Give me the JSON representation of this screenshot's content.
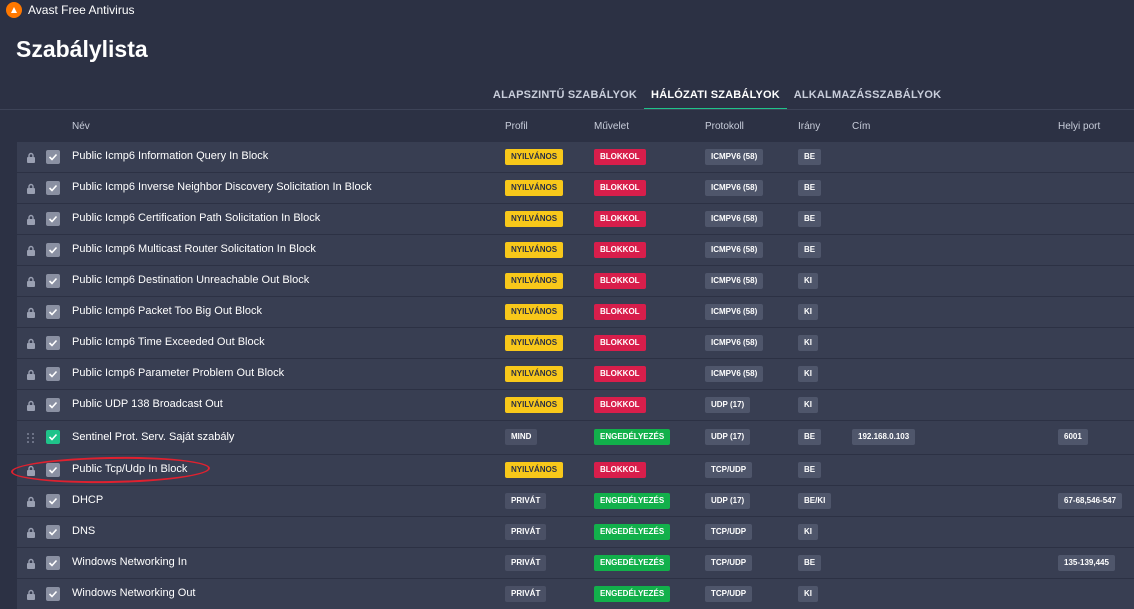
{
  "app": {
    "title": "Avast Free Antivirus"
  },
  "page": {
    "title": "Szabálylista"
  },
  "tabs": [
    {
      "label": "ALAPSZINTŰ SZABÁLYOK",
      "active": false
    },
    {
      "label": "HÁLÓZATI SZABÁLYOK",
      "active": true
    },
    {
      "label": "ALKALMAZÁSSZABÁLYOK",
      "active": false
    }
  ],
  "columns": {
    "name": "Név",
    "profile": "Profil",
    "action": "Művelet",
    "protocol": "Protokoll",
    "direction": "Irány",
    "address": "Cím",
    "local_port": "Helyi port"
  },
  "colors": {
    "public": "#f8c81a",
    "block": "#d81e4b",
    "allow": "#12b04b",
    "accent_tab": "#1fc38a",
    "annotation": "#e0212f"
  },
  "rows": [
    {
      "name": "Public Icmp6 Information Query In Block",
      "profile": "NYILVÁNOS",
      "action": "BLOKKOL",
      "protocol": "ICMPV6 (58)",
      "direction": "BE",
      "address": "",
      "port": ""
    },
    {
      "name": "Public Icmp6 Inverse Neighbor Discovery Solicitation In Block",
      "profile": "NYILVÁNOS",
      "action": "BLOKKOL",
      "protocol": "ICMPV6 (58)",
      "direction": "BE",
      "address": "",
      "port": ""
    },
    {
      "name": "Public Icmp6 Certification Path Solicitation In Block",
      "profile": "NYILVÁNOS",
      "action": "BLOKKOL",
      "protocol": "ICMPV6 (58)",
      "direction": "BE",
      "address": "",
      "port": ""
    },
    {
      "name": "Public Icmp6 Multicast Router Solicitation In Block",
      "profile": "NYILVÁNOS",
      "action": "BLOKKOL",
      "protocol": "ICMPV6 (58)",
      "direction": "BE",
      "address": "",
      "port": ""
    },
    {
      "name": "Public Icmp6 Destination Unreachable Out Block",
      "profile": "NYILVÁNOS",
      "action": "BLOKKOL",
      "protocol": "ICMPV6 (58)",
      "direction": "KI",
      "address": "",
      "port": ""
    },
    {
      "name": "Public Icmp6 Packet Too Big Out Block",
      "profile": "NYILVÁNOS",
      "action": "BLOKKOL",
      "protocol": "ICMPV6 (58)",
      "direction": "KI",
      "address": "",
      "port": ""
    },
    {
      "name": "Public Icmp6 Time Exceeded Out Block",
      "profile": "NYILVÁNOS",
      "action": "BLOKKOL",
      "protocol": "ICMPV6 (58)",
      "direction": "KI",
      "address": "",
      "port": ""
    },
    {
      "name": "Public Icmp6 Parameter Problem Out Block",
      "profile": "NYILVÁNOS",
      "action": "BLOKKOL",
      "protocol": "ICMPV6 (58)",
      "direction": "KI",
      "address": "",
      "port": ""
    },
    {
      "name": "Public UDP 138 Broadcast Out",
      "profile": "NYILVÁNOS",
      "action": "BLOKKOL",
      "protocol": "UDP (17)",
      "direction": "KI",
      "address": "",
      "port": ""
    },
    {
      "name": "Sentinel Prot. Serv. Saját szabály",
      "profile": "MIND",
      "action": "ENGEDÉLYEZÉS",
      "protocol": "UDP (17)",
      "direction": "BE",
      "address": "192.168.0.103",
      "port": "6001"
    },
    {
      "name": "Public Tcp/Udp In Block",
      "profile": "NYILVÁNOS",
      "action": "BLOKKOL",
      "protocol": "TCP/UDP",
      "direction": "BE",
      "address": "",
      "port": ""
    },
    {
      "name": "DHCP",
      "profile": "PRIVÁT",
      "action": "ENGEDÉLYEZÉS",
      "protocol": "UDP (17)",
      "direction": "BE/KI",
      "address": "",
      "port": "67-68,546-547"
    },
    {
      "name": "DNS",
      "profile": "PRIVÁT",
      "action": "ENGEDÉLYEZÉS",
      "protocol": "TCP/UDP",
      "direction": "KI",
      "address": "",
      "port": ""
    },
    {
      "name": "Windows Networking In",
      "profile": "PRIVÁT",
      "action": "ENGEDÉLYEZÉS",
      "protocol": "TCP/UDP",
      "direction": "BE",
      "address": "",
      "port": "135-139,445"
    },
    {
      "name": "Windows Networking Out",
      "profile": "PRIVÁT",
      "action": "ENGEDÉLYEZÉS",
      "protocol": "TCP/UDP",
      "direction": "KI",
      "address": "",
      "port": ""
    }
  ]
}
